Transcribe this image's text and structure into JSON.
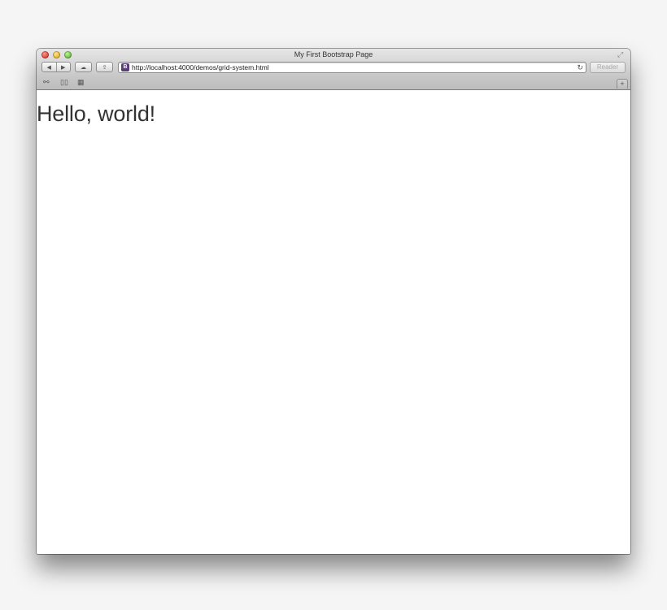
{
  "window": {
    "title": "My First Bootstrap Page"
  },
  "toolbar": {
    "back_icon": "◀",
    "forward_icon": "▶",
    "icloud_icon": "☁",
    "share_icon": "⇪",
    "url": "http://localhost:4000/demos/grid-system.html",
    "reload_icon": "↻",
    "reader_label": "Reader"
  },
  "bookmarks_bar": {
    "reading_list_icon": "⚯",
    "bookmarks_icon": "📖",
    "top_sites_icon": "▦",
    "new_tab_label": "+"
  },
  "page": {
    "heading": "Hello, world!"
  },
  "colors": {
    "heading": "#333333",
    "reader_disabled": "#a9a9a9"
  },
  "icons": [
    "close-icon",
    "minimize-icon",
    "zoom-icon",
    "fullscreen-icon",
    "back-icon",
    "forward-icon",
    "icloud-icon",
    "share-icon",
    "favicon-icon",
    "reload-icon",
    "reading-list-icon",
    "bookmarks-icon",
    "top-sites-icon"
  ]
}
